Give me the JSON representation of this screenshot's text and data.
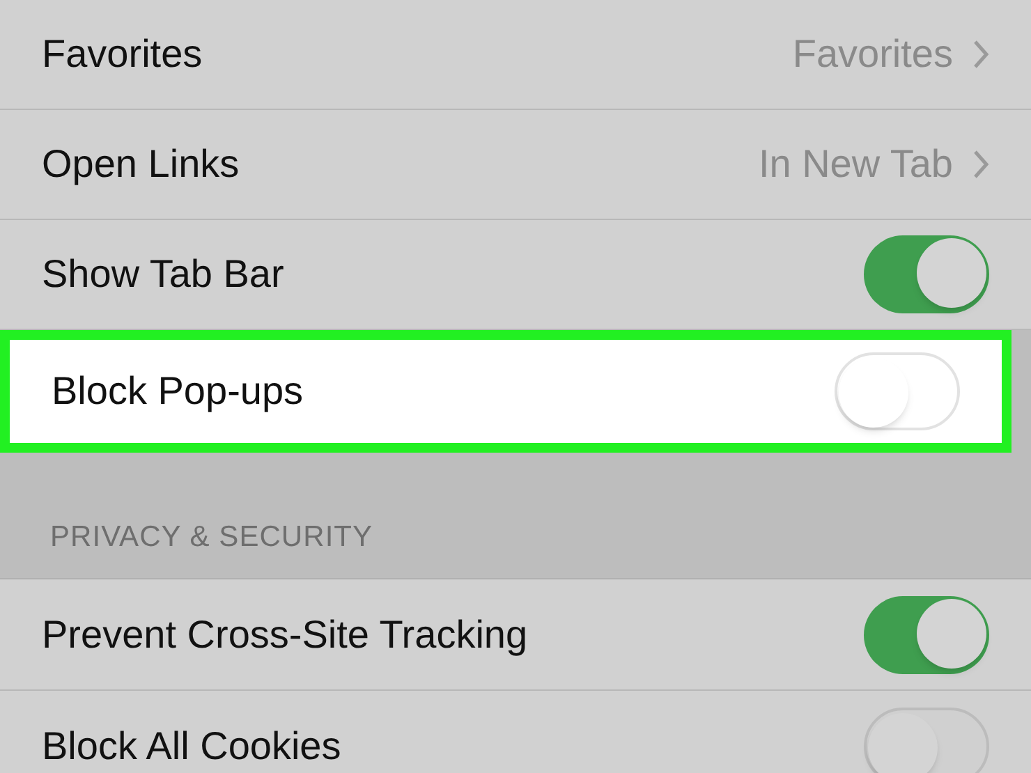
{
  "rows": [
    {
      "kind": "link",
      "label": "Favorites",
      "value": "Favorites",
      "highlighted": false
    },
    {
      "kind": "link",
      "label": "Open Links",
      "value": "In New Tab",
      "highlighted": false
    },
    {
      "kind": "toggle",
      "label": "Show Tab Bar",
      "on": true,
      "highlighted": false
    },
    {
      "kind": "toggle",
      "label": "Block Pop-ups",
      "on": false,
      "highlighted": true
    }
  ],
  "section": {
    "header": "PRIVACY & SECURITY",
    "rows": [
      {
        "kind": "toggle",
        "label": "Prevent Cross-Site Tracking",
        "on": true,
        "highlighted": false
      },
      {
        "kind": "toggle",
        "label": "Block All Cookies",
        "on": false,
        "highlighted": false
      }
    ]
  }
}
